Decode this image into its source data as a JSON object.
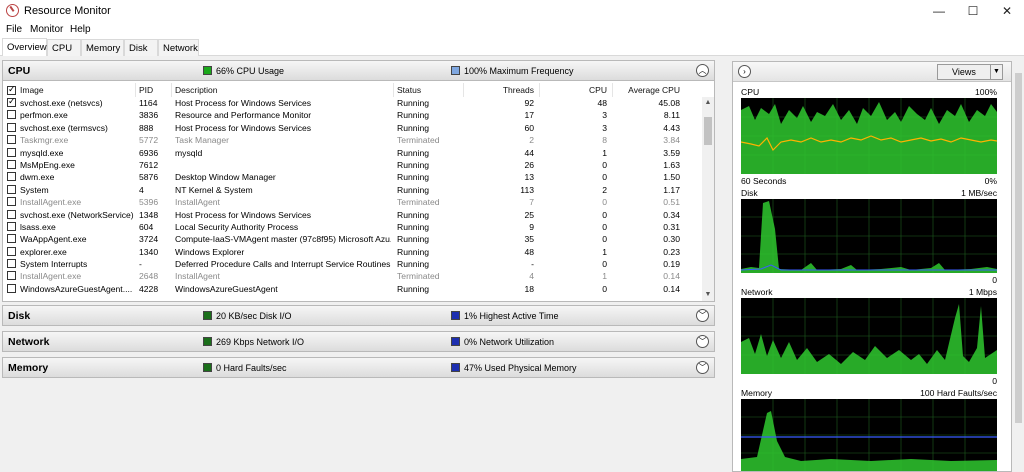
{
  "window": {
    "title": "Resource Monitor",
    "minimize": "—",
    "maximize": "☐",
    "close": "✕"
  },
  "menu": {
    "file": "File",
    "monitor": "Monitor",
    "help": "Help"
  },
  "tabs": [
    "Overview",
    "CPU",
    "Memory",
    "Disk",
    "Network"
  ],
  "cpu": {
    "title": "CPU",
    "usage": "66% CPU Usage",
    "usage_color": "#1aa81a",
    "frequency": "100% Maximum Frequency",
    "frequency_color": "#7fa7e0",
    "columns": [
      "Image",
      "PID",
      "Description",
      "Status",
      "Threads",
      "CPU",
      "Average CPU"
    ],
    "rows": [
      {
        "checked": true,
        "image": "svchost.exe (netsvcs)",
        "pid": "1164",
        "desc": "Host Process for Windows Services",
        "status": "Running",
        "threads": "92",
        "cpu": "48",
        "avg": "45.08",
        "terminated": false
      },
      {
        "checked": false,
        "image": "perfmon.exe",
        "pid": "3836",
        "desc": "Resource and Performance Monitor",
        "status": "Running",
        "threads": "17",
        "cpu": "3",
        "avg": "8.11",
        "terminated": false
      },
      {
        "checked": false,
        "image": "svchost.exe (termsvcs)",
        "pid": "888",
        "desc": "Host Process for Windows Services",
        "status": "Running",
        "threads": "60",
        "cpu": "3",
        "avg": "4.43",
        "terminated": false
      },
      {
        "checked": false,
        "image": "Taskmgr.exe",
        "pid": "5772",
        "desc": "Task Manager",
        "status": "Terminated",
        "threads": "2",
        "cpu": "8",
        "avg": "3.84",
        "terminated": true
      },
      {
        "checked": false,
        "image": "mysqld.exe",
        "pid": "6936",
        "desc": "mysqld",
        "status": "Running",
        "threads": "44",
        "cpu": "1",
        "avg": "3.59",
        "terminated": false
      },
      {
        "checked": false,
        "image": "MsMpEng.exe",
        "pid": "7612",
        "desc": "",
        "status": "Running",
        "threads": "26",
        "cpu": "0",
        "avg": "1.63",
        "terminated": false
      },
      {
        "checked": false,
        "image": "dwm.exe",
        "pid": "5876",
        "desc": "Desktop Window Manager",
        "status": "Running",
        "threads": "13",
        "cpu": "0",
        "avg": "1.50",
        "terminated": false
      },
      {
        "checked": false,
        "image": "System",
        "pid": "4",
        "desc": "NT Kernel & System",
        "status": "Running",
        "threads": "113",
        "cpu": "2",
        "avg": "1.17",
        "terminated": false
      },
      {
        "checked": false,
        "image": "InstallAgent.exe",
        "pid": "5396",
        "desc": "InstallAgent",
        "status": "Terminated",
        "threads": "7",
        "cpu": "0",
        "avg": "0.51",
        "terminated": true
      },
      {
        "checked": false,
        "image": "svchost.exe (NetworkService)",
        "pid": "1348",
        "desc": "Host Process for Windows Services",
        "status": "Running",
        "threads": "25",
        "cpu": "0",
        "avg": "0.34",
        "terminated": false
      },
      {
        "checked": false,
        "image": "lsass.exe",
        "pid": "604",
        "desc": "Local Security Authority Process",
        "status": "Running",
        "threads": "9",
        "cpu": "0",
        "avg": "0.31",
        "terminated": false
      },
      {
        "checked": false,
        "image": "WaAppAgent.exe",
        "pid": "3724",
        "desc": "Compute-IaaS-VMAgent master (97c8f95) Microsoft Azu...",
        "status": "Running",
        "threads": "35",
        "cpu": "0",
        "avg": "0.30",
        "terminated": false
      },
      {
        "checked": false,
        "image": "explorer.exe",
        "pid": "1340",
        "desc": "Windows Explorer",
        "status": "Running",
        "threads": "48",
        "cpu": "1",
        "avg": "0.23",
        "terminated": false
      },
      {
        "checked": false,
        "image": "System Interrupts",
        "pid": "-",
        "desc": "Deferred Procedure Calls and Interrupt Service Routines",
        "status": "Running",
        "threads": "-",
        "cpu": "0",
        "avg": "0.19",
        "terminated": false
      },
      {
        "checked": false,
        "image": "InstallAgent.exe",
        "pid": "2648",
        "desc": "InstallAgent",
        "status": "Terminated",
        "threads": "4",
        "cpu": "1",
        "avg": "0.14",
        "terminated": true
      },
      {
        "checked": false,
        "image": "WindowsAzureGuestAgent....",
        "pid": "4228",
        "desc": "WindowsAzureGuestAgent",
        "status": "Running",
        "threads": "18",
        "cpu": "0",
        "avg": "0.14",
        "terminated": false
      }
    ]
  },
  "disk": {
    "title": "Disk",
    "io": "20 KB/sec Disk I/O",
    "io_color": "#1a6e1a",
    "active": "1% Highest Active Time",
    "active_color": "#1d2fb0"
  },
  "network": {
    "title": "Network",
    "io": "269 Kbps Network I/O",
    "io_color": "#1a6e1a",
    "util": "0% Network Utilization",
    "util_color": "#1d2fb0"
  },
  "memory": {
    "title": "Memory",
    "faults": "0 Hard Faults/sec",
    "faults_color": "#1a6e1a",
    "used": "47% Used Physical Memory",
    "used_color": "#1d2fb0"
  },
  "side": {
    "views_label": "Views",
    "graphs": [
      {
        "name": "CPU",
        "max": "100%",
        "left_bottom": "60 Seconds",
        "right_bottom": "0%"
      },
      {
        "name": "Disk",
        "max": "1 MB/sec",
        "left_bottom": "",
        "right_bottom": "0"
      },
      {
        "name": "Network",
        "max": "1 Mbps",
        "left_bottom": "",
        "right_bottom": "0"
      },
      {
        "name": "Memory",
        "max": "100 Hard Faults/sec",
        "left_bottom": "",
        "right_bottom": ""
      }
    ]
  }
}
